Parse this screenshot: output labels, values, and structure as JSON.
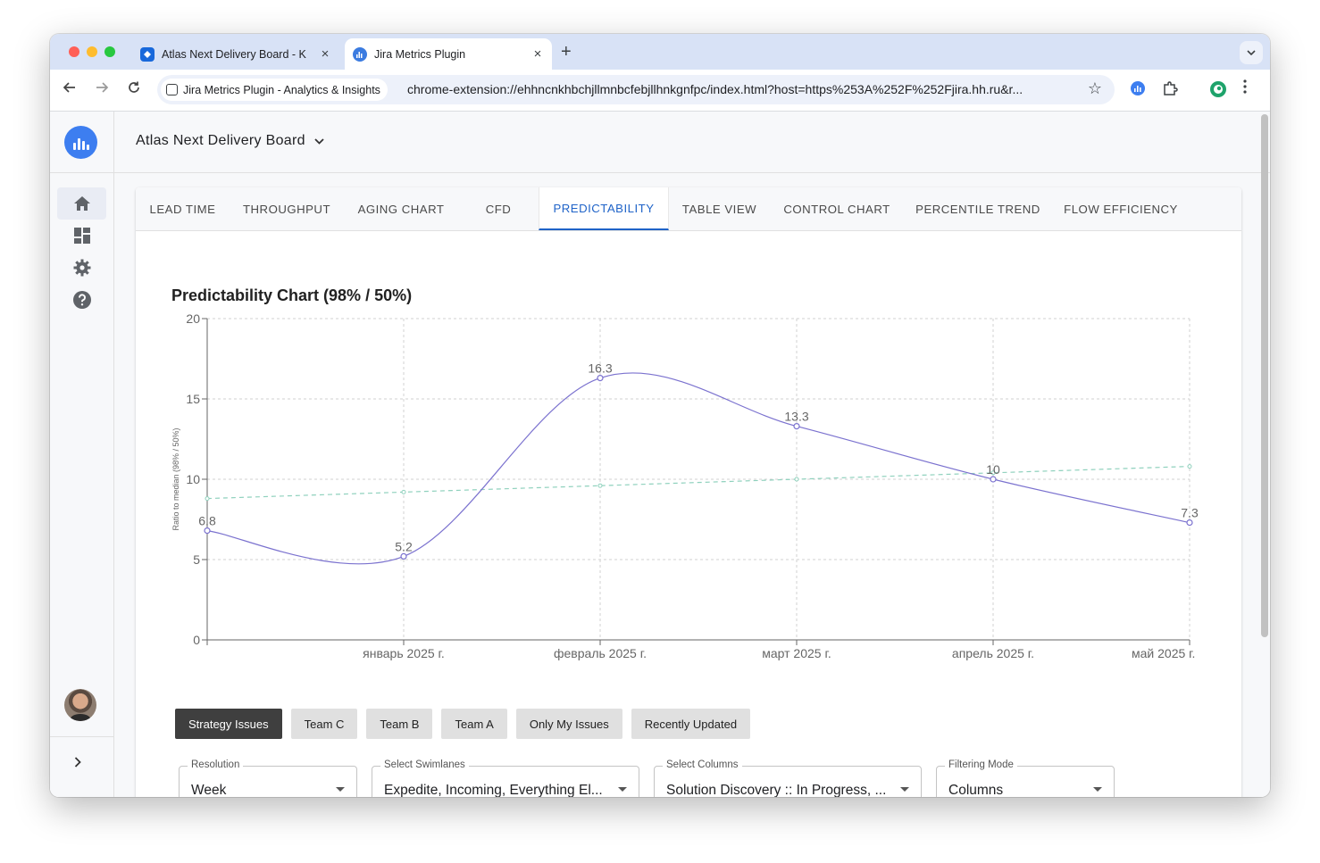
{
  "browser": {
    "tabs": [
      {
        "title": "Atlas Next Delivery Board - K",
        "close": "×"
      },
      {
        "title": "Jira Metrics Plugin",
        "close": "×"
      }
    ],
    "new_tab": "+",
    "site_chip": "Jira Metrics Plugin - Analytics & Insights",
    "url": "chrome-extension://ehhncnkhbchjllmnbcfebjllhnkgnfpc/index.html?host=https%253A%252F%252Fjira.hh.ru&r..."
  },
  "app": {
    "board_name": "Atlas Next Delivery Board",
    "sidebar_items": [
      "home",
      "dashboard",
      "settings",
      "help"
    ],
    "tabs": [
      "LEAD TIME",
      "THROUGHPUT",
      "AGING CHART",
      "CFD",
      "PREDICTABILITY",
      "TABLE VIEW",
      "CONTROL CHART",
      "PERCENTILE TREND",
      "FLOW EFFICIENCY"
    ],
    "active_tab": "PREDICTABILITY",
    "chart_title": "Predictability Chart (98% / 50%)",
    "filters": [
      "Strategy Issues",
      "Team C",
      "Team B",
      "Team A",
      "Only My Issues",
      "Recently Updated"
    ],
    "active_filter": "Strategy Issues",
    "selects": [
      {
        "label": "Resolution",
        "value": "Week"
      },
      {
        "label": "Select Swimlanes",
        "value": "Expedite, Incoming, Everything El..."
      },
      {
        "label": "Select Columns",
        "value": "Solution Discovery :: In Progress, ..."
      },
      {
        "label": "Filtering Mode",
        "value": "Columns"
      }
    ]
  },
  "colors": {
    "accent": "#1f63c8",
    "main_line": "#7b72cf",
    "trend_line": "#8fd1bd",
    "logo": "#3d7ef0"
  },
  "chart_data": {
    "type": "line",
    "title": "Predictability Chart (98% / 50%)",
    "ylabel": "Ratio to median (98% / 50%)",
    "xlabel": "",
    "ylim": [
      0,
      20
    ],
    "yticks": [
      0,
      5,
      10,
      15,
      20
    ],
    "x": [
      "",
      "январь 2025 г.",
      "февраль 2025 г.",
      "март 2025 г.",
      "апрель 2025 г.",
      "май 2025 г."
    ],
    "series": [
      {
        "values": [
          6.8,
          5.2,
          16.3,
          13.3,
          10,
          7.3
        ],
        "labels": [
          "6.8",
          "5.2",
          "16.3",
          "13.3",
          "10",
          "7.3"
        ],
        "style": "solid"
      },
      {
        "values": [
          8.8,
          9.2,
          9.6,
          10.0,
          10.4,
          10.8
        ],
        "style": "dashed"
      }
    ],
    "grid": true
  }
}
